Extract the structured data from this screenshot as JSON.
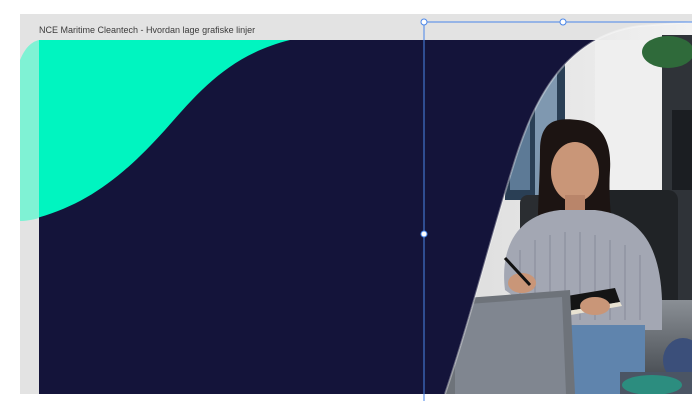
{
  "frame": {
    "title": "NCE Maritime Cleantech - Hvordan lage grafiske linjer"
  },
  "colors": {
    "navy": "#14143a",
    "mint": "#00f5c0",
    "selection_blue": "#4a86e8",
    "canvas_bg": "#e3e3e3"
  },
  "photo": {
    "subject": "smiling woman in grey knit sweater holding pen and notebook in office"
  }
}
